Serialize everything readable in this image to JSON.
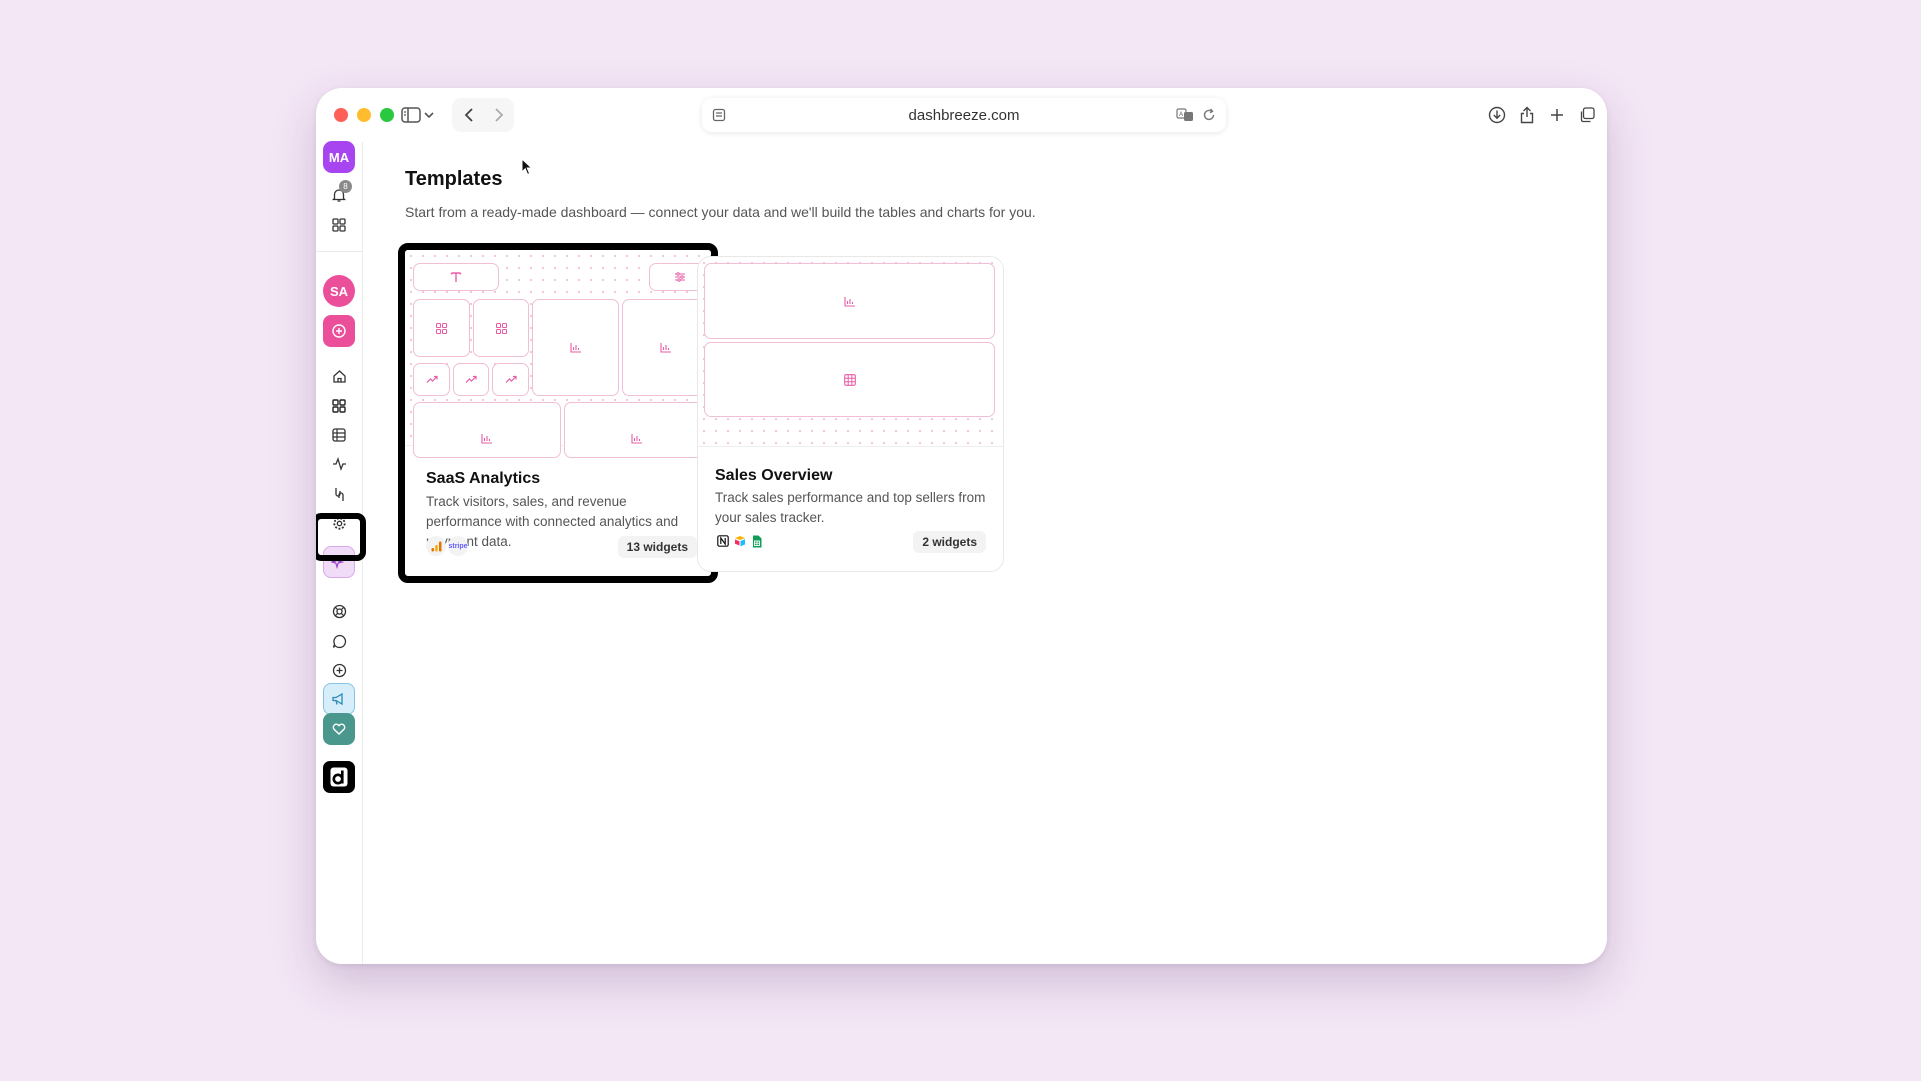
{
  "browser": {
    "url": "dashbreeze.com"
  },
  "sidebar": {
    "top_avatar": "MA",
    "notification_count": "8",
    "workspace_avatar": "SA"
  },
  "page": {
    "title": "Templates",
    "subtitle": "Start from a ready-made dashboard — connect your data and we'll build the tables and charts for you."
  },
  "templates": [
    {
      "title": "SaaS Analytics",
      "description": "Track visitors, sales, and revenue performance with connected analytics and payment data.",
      "widgets": "13 widgets",
      "sources": [
        "google-analytics-icon",
        "stripe-icon"
      ],
      "stripe_label": "stripe"
    },
    {
      "title": "Sales Overview",
      "description": "Track sales performance and top sellers from your sales tracker.",
      "widgets": "2 widgets",
      "sources": [
        "notion-icon",
        "airtable-icon",
        "google-sheets-icon"
      ]
    }
  ],
  "colors": {
    "background": "#f3e6f5",
    "accent_pink": "#e85da6",
    "avatar_purple": "#a745f0",
    "avatar_pink": "#ec4f9a"
  }
}
